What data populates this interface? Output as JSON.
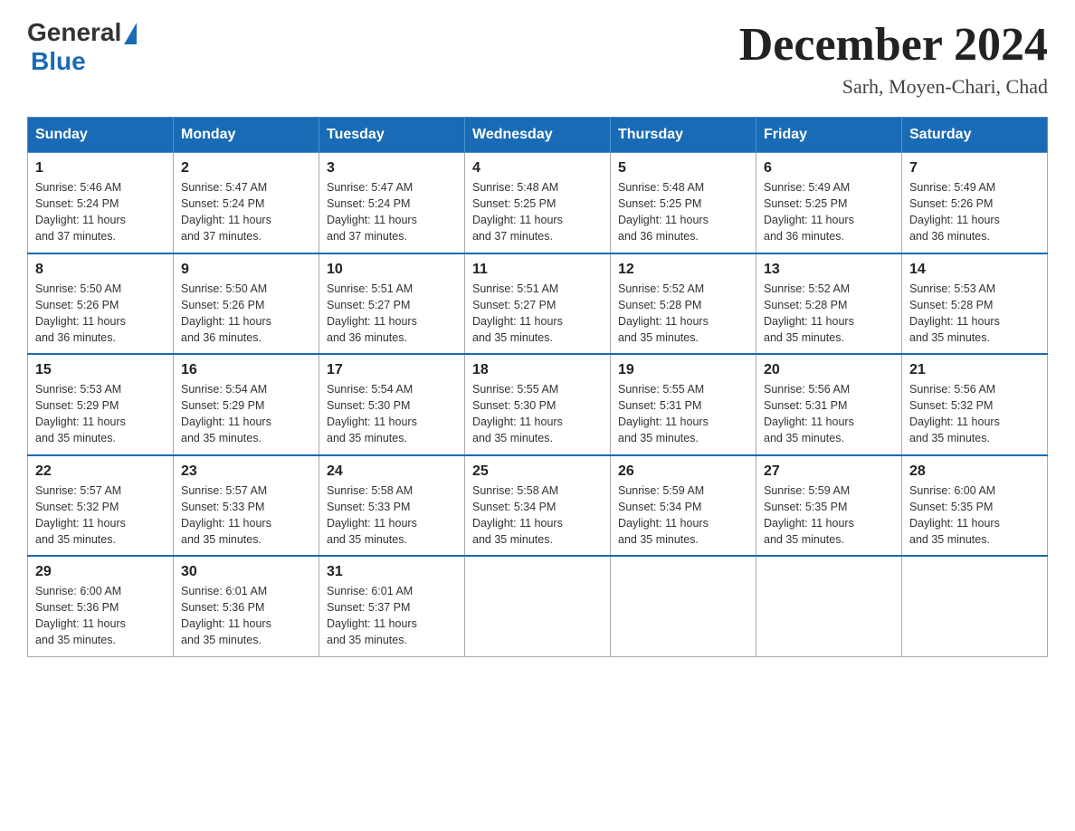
{
  "logo": {
    "general": "General",
    "blue": "Blue"
  },
  "title": "December 2024",
  "location": "Sarh, Moyen-Chari, Chad",
  "days_of_week": [
    "Sunday",
    "Monday",
    "Tuesday",
    "Wednesday",
    "Thursday",
    "Friday",
    "Saturday"
  ],
  "weeks": [
    [
      {
        "day": "1",
        "sunrise": "5:46 AM",
        "sunset": "5:24 PM",
        "daylight": "11 hours and 37 minutes."
      },
      {
        "day": "2",
        "sunrise": "5:47 AM",
        "sunset": "5:24 PM",
        "daylight": "11 hours and 37 minutes."
      },
      {
        "day": "3",
        "sunrise": "5:47 AM",
        "sunset": "5:24 PM",
        "daylight": "11 hours and 37 minutes."
      },
      {
        "day": "4",
        "sunrise": "5:48 AM",
        "sunset": "5:25 PM",
        "daylight": "11 hours and 37 minutes."
      },
      {
        "day": "5",
        "sunrise": "5:48 AM",
        "sunset": "5:25 PM",
        "daylight": "11 hours and 36 minutes."
      },
      {
        "day": "6",
        "sunrise": "5:49 AM",
        "sunset": "5:25 PM",
        "daylight": "11 hours and 36 minutes."
      },
      {
        "day": "7",
        "sunrise": "5:49 AM",
        "sunset": "5:26 PM",
        "daylight": "11 hours and 36 minutes."
      }
    ],
    [
      {
        "day": "8",
        "sunrise": "5:50 AM",
        "sunset": "5:26 PM",
        "daylight": "11 hours and 36 minutes."
      },
      {
        "day": "9",
        "sunrise": "5:50 AM",
        "sunset": "5:26 PM",
        "daylight": "11 hours and 36 minutes."
      },
      {
        "day": "10",
        "sunrise": "5:51 AM",
        "sunset": "5:27 PM",
        "daylight": "11 hours and 36 minutes."
      },
      {
        "day": "11",
        "sunrise": "5:51 AM",
        "sunset": "5:27 PM",
        "daylight": "11 hours and 35 minutes."
      },
      {
        "day": "12",
        "sunrise": "5:52 AM",
        "sunset": "5:28 PM",
        "daylight": "11 hours and 35 minutes."
      },
      {
        "day": "13",
        "sunrise": "5:52 AM",
        "sunset": "5:28 PM",
        "daylight": "11 hours and 35 minutes."
      },
      {
        "day": "14",
        "sunrise": "5:53 AM",
        "sunset": "5:28 PM",
        "daylight": "11 hours and 35 minutes."
      }
    ],
    [
      {
        "day": "15",
        "sunrise": "5:53 AM",
        "sunset": "5:29 PM",
        "daylight": "11 hours and 35 minutes."
      },
      {
        "day": "16",
        "sunrise": "5:54 AM",
        "sunset": "5:29 PM",
        "daylight": "11 hours and 35 minutes."
      },
      {
        "day": "17",
        "sunrise": "5:54 AM",
        "sunset": "5:30 PM",
        "daylight": "11 hours and 35 minutes."
      },
      {
        "day": "18",
        "sunrise": "5:55 AM",
        "sunset": "5:30 PM",
        "daylight": "11 hours and 35 minutes."
      },
      {
        "day": "19",
        "sunrise": "5:55 AM",
        "sunset": "5:31 PM",
        "daylight": "11 hours and 35 minutes."
      },
      {
        "day": "20",
        "sunrise": "5:56 AM",
        "sunset": "5:31 PM",
        "daylight": "11 hours and 35 minutes."
      },
      {
        "day": "21",
        "sunrise": "5:56 AM",
        "sunset": "5:32 PM",
        "daylight": "11 hours and 35 minutes."
      }
    ],
    [
      {
        "day": "22",
        "sunrise": "5:57 AM",
        "sunset": "5:32 PM",
        "daylight": "11 hours and 35 minutes."
      },
      {
        "day": "23",
        "sunrise": "5:57 AM",
        "sunset": "5:33 PM",
        "daylight": "11 hours and 35 minutes."
      },
      {
        "day": "24",
        "sunrise": "5:58 AM",
        "sunset": "5:33 PM",
        "daylight": "11 hours and 35 minutes."
      },
      {
        "day": "25",
        "sunrise": "5:58 AM",
        "sunset": "5:34 PM",
        "daylight": "11 hours and 35 minutes."
      },
      {
        "day": "26",
        "sunrise": "5:59 AM",
        "sunset": "5:34 PM",
        "daylight": "11 hours and 35 minutes."
      },
      {
        "day": "27",
        "sunrise": "5:59 AM",
        "sunset": "5:35 PM",
        "daylight": "11 hours and 35 minutes."
      },
      {
        "day": "28",
        "sunrise": "6:00 AM",
        "sunset": "5:35 PM",
        "daylight": "11 hours and 35 minutes."
      }
    ],
    [
      {
        "day": "29",
        "sunrise": "6:00 AM",
        "sunset": "5:36 PM",
        "daylight": "11 hours and 35 minutes."
      },
      {
        "day": "30",
        "sunrise": "6:01 AM",
        "sunset": "5:36 PM",
        "daylight": "11 hours and 35 minutes."
      },
      {
        "day": "31",
        "sunrise": "6:01 AM",
        "sunset": "5:37 PM",
        "daylight": "11 hours and 35 minutes."
      },
      null,
      null,
      null,
      null
    ]
  ]
}
